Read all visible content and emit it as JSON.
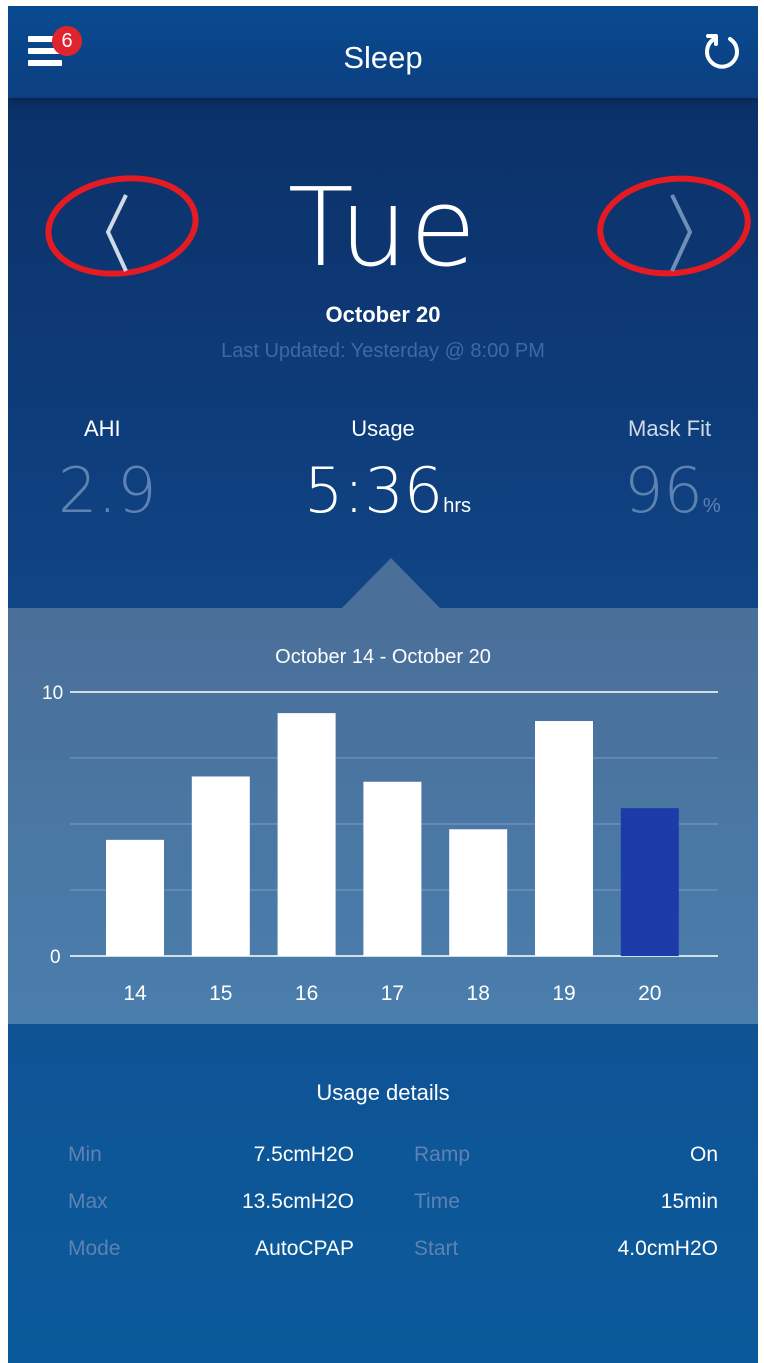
{
  "header": {
    "title": "Sleep",
    "notification_count": "6",
    "menu_icon": "hamburger-menu-icon",
    "refresh_icon": "refresh-icon"
  },
  "day_nav": {
    "day": "Tue",
    "date": "October 20",
    "last_updated": "Last Updated: Yesterday @ 8:00 PM",
    "prev_icon": "chevron-left-icon",
    "next_icon": "chevron-right-icon"
  },
  "stats": {
    "ahi": {
      "label": "AHI",
      "value": "2.9"
    },
    "usage": {
      "label": "Usage",
      "value": "5:36",
      "unit": "hrs"
    },
    "mask_fit": {
      "label": "Mask Fit",
      "value": "96",
      "unit": "%"
    }
  },
  "chart_data": {
    "type": "bar",
    "title": "October 14 - October 20",
    "categories": [
      "14",
      "15",
      "16",
      "17",
      "18",
      "19",
      "20"
    ],
    "values": [
      4.4,
      6.8,
      9.2,
      6.6,
      4.8,
      8.9,
      5.6
    ],
    "ylim": [
      0,
      10
    ],
    "yticks": [
      "0",
      "10"
    ],
    "grid": true,
    "highlight_index": 6,
    "colors": {
      "bar": "#ffffff",
      "highlight": "#1c3aa8"
    }
  },
  "usage_details": {
    "title": "Usage details",
    "rows": [
      {
        "l1": "Min",
        "v1": "7.5cmH2O",
        "l2": "Ramp",
        "v2": "On"
      },
      {
        "l1": "Max",
        "v1": "13.5cmH2O",
        "l2": "Time",
        "v2": "15min"
      },
      {
        "l1": "Mode",
        "v1": "AutoCPAP",
        "l2": "Start",
        "v2": "4.0cmH2O"
      }
    ]
  },
  "colors": {
    "accent_red": "#e0242e",
    "label_blue": "#5e82b2"
  }
}
